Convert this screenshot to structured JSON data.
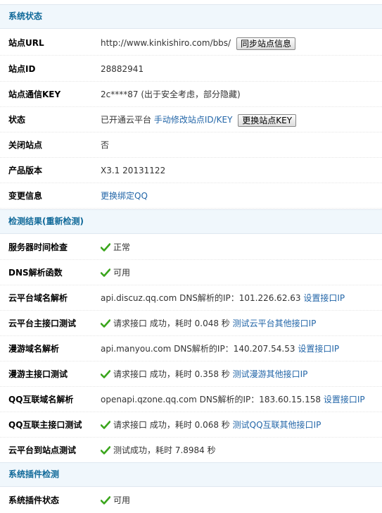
{
  "sections": {
    "status": "系统状态",
    "detect": "检测结果(重新检测)",
    "plugins": "系统插件检测"
  },
  "status": {
    "url": {
      "label": "站点URL",
      "value": "http://www.kinkishiro.com/bbs/",
      "button": "同步站点信息"
    },
    "id": {
      "label": "站点ID",
      "value": "28882941"
    },
    "key": {
      "label": "站点通信KEY",
      "value": "2c****87 (出于安全考虑，部分隐藏)"
    },
    "state": {
      "label": "状态",
      "value": "已开通云平台",
      "link": "手动修改站点ID/KEY",
      "button": "更换站点KEY"
    },
    "closed": {
      "label": "关闭站点",
      "value": "否"
    },
    "version": {
      "label": "产品版本",
      "value": "X3.1 20131122"
    },
    "change": {
      "label": "变更信息",
      "link": "更换绑定QQ"
    }
  },
  "detect": {
    "time": {
      "label": "服务器时间检查",
      "value": "正常"
    },
    "dns": {
      "label": "DNS解析函数",
      "value": "可用"
    },
    "cloud_domain": {
      "label": "云平台域名解析",
      "value": "api.discuz.qq.com DNS解析的IP：101.226.62.63",
      "link": "设置接口IP"
    },
    "cloud_api": {
      "label": "云平台主接口测试",
      "value": "请求接口 成功，耗时 0.048 秒",
      "link": "测试云平台其他接口IP"
    },
    "manyou_domain": {
      "label": "漫游域名解析",
      "value": "api.manyou.com DNS解析的IP：140.207.54.53",
      "link": "设置接口IP"
    },
    "manyou_api": {
      "label": "漫游主接口测试",
      "value": "请求接口 成功，耗时 0.358 秒",
      "link": "测试漫游其他接口IP"
    },
    "qq_domain": {
      "label": "QQ互联域名解析",
      "value": "openapi.qzone.qq.com DNS解析的IP：183.60.15.158",
      "link": "设置接口IP"
    },
    "qq_api": {
      "label": "QQ互联主接口测试",
      "value": "请求接口 成功，耗时 0.068 秒",
      "link": "测试QQ互联其他接口IP"
    },
    "site_test": {
      "label": "云平台到站点测试",
      "value": "测试成功，耗时 7.8984 秒"
    }
  },
  "plugins": {
    "state": {
      "label": "系统插件状态",
      "value": "可用"
    }
  },
  "colors": {
    "header_bg": "#f0f7fc",
    "header_text": "#106999",
    "link": "#2366a8",
    "check": "#3aa51c"
  }
}
